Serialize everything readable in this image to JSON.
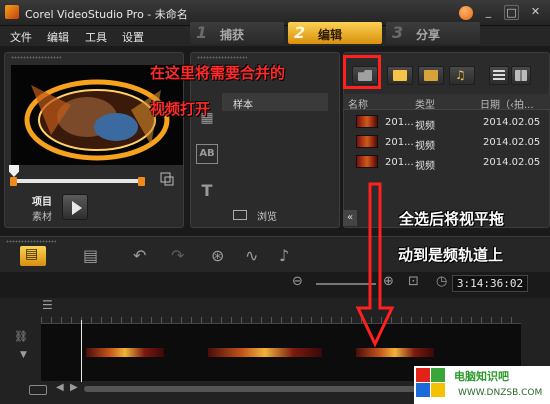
{
  "window": {
    "title": "Corel VideoStudio Pro - 未命名"
  },
  "menu": [
    "文件",
    "编辑",
    "工具",
    "设置"
  ],
  "steps": [
    {
      "num": "1",
      "label": "捕获"
    },
    {
      "num": "2",
      "label": "编辑"
    },
    {
      "num": "3",
      "label": "分享"
    }
  ],
  "player": {
    "project_label": "项目",
    "clip_label": "素材"
  },
  "library": {
    "folder_name": "样本",
    "browse_label": "浏览",
    "columns": [
      "名称",
      "类型",
      "日期（‹拍..."
    ],
    "files": [
      {
        "name": "201...",
        "type": "视频",
        "date": "2014.02.05"
      },
      {
        "name": "201...",
        "type": "视频",
        "date": "2014.02.05"
      },
      {
        "name": "201...",
        "type": "视频",
        "date": "2014.02.05"
      }
    ]
  },
  "timeline": {
    "timecode": "3:14:36:02"
  },
  "annotations": {
    "top_line1": "在这里将需要合并的",
    "top_line2": "视频打开",
    "right_line1": "全选后将视平拖",
    "right_line2": "动到是频轨道上"
  },
  "watermark": {
    "title": "电脑知识吧",
    "url": "WWW.DNZSB.COM"
  },
  "colors": {
    "accent": "#f0a41f",
    "annotation": "#ff2a2a"
  }
}
